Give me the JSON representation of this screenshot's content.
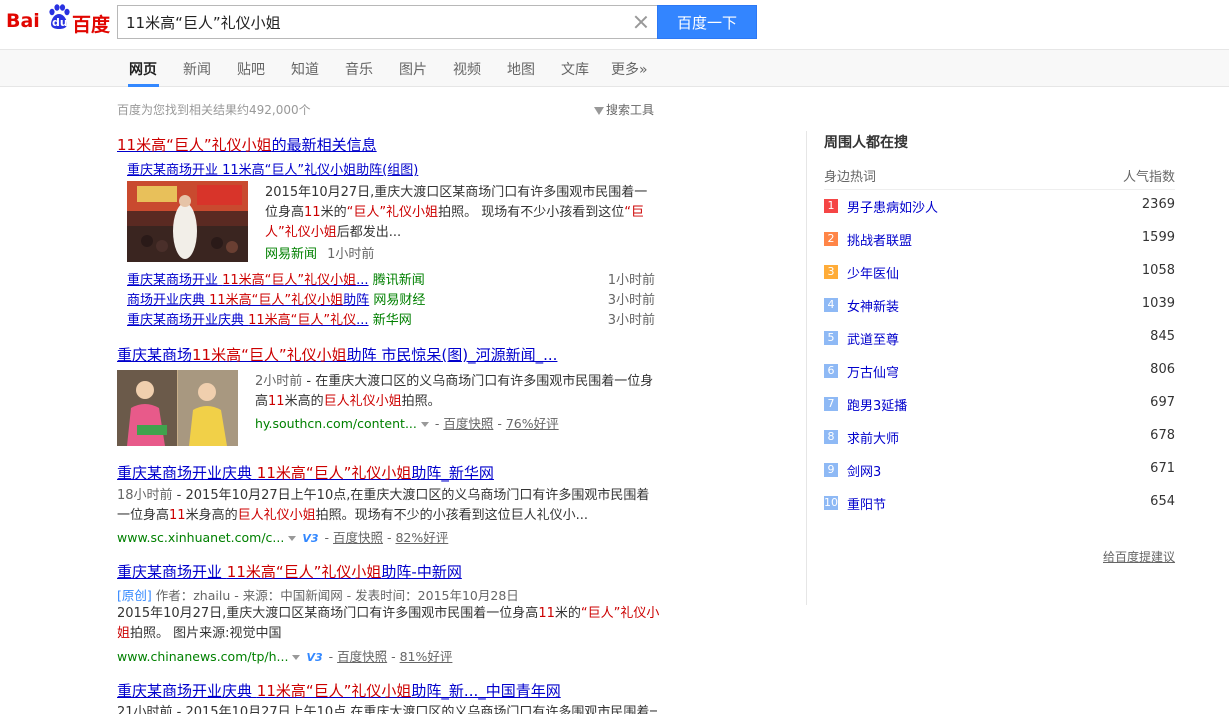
{
  "logo": {
    "left": "Bai",
    "paw": "du",
    "right": "百度"
  },
  "search": {
    "value": "11米高“巨人”礼仪小姐",
    "button_label": "百度一下"
  },
  "tabs": [
    "网页",
    "新闻",
    "贴吧",
    "知道",
    "音乐",
    "图片",
    "视频",
    "地图",
    "文库",
    "更多»"
  ],
  "results_info": {
    "count_text": "百度为您找到相关结果约492,000个",
    "tools_label": "搜索工具"
  },
  "news_block": {
    "title_a": "11米高“巨人”礼仪小姐",
    "title_b": "的最新相关信息",
    "sub_title": "重庆某商场开业 11米高“巨人”礼仪小姐助阵(组图)",
    "snippet_a": "2015年10月27日,重庆大渡口区某商场门口有许多围观市民围着一位身高",
    "snippet_em1": "11",
    "snippet_b": "米的",
    "snippet_em2": "“巨人”礼仪小姐",
    "snippet_c": "拍照。 现场有不少小孩看到这位",
    "snippet_em3": "“巨人”礼仪小姐",
    "snippet_d": "后都发出...",
    "source": "网易新闻",
    "time": "1小时前",
    "rows": [
      {
        "a": "重庆某商场开业 ",
        "em": "11米高“巨人”礼仪小姐",
        "b": "...",
        "source": "腾讯新闻",
        "time": "1小时前"
      },
      {
        "a": "商场开业庆典 ",
        "em": "11米高“巨人”礼仪小姐",
        "b": "助阵",
        "source": "网易财经",
        "time": "3小时前"
      },
      {
        "a": "重庆某商场开业庆典 ",
        "em": "11米高“巨人”礼仪",
        "b": "...",
        "source": "新华网",
        "time": "3小时前"
      }
    ]
  },
  "result2": {
    "title_a": "重庆某商场",
    "title_em": "11米高“巨人”礼仪小姐",
    "title_b": "助阵 市民惊呆(图)_河源新闻_...",
    "time": "2小时前",
    "snippet_a": " - 在重庆大渡口区的义乌商场门口有许多围观市民围着一位身高",
    "snippet_em1": "11",
    "snippet_b": "米高的",
    "snippet_em2": "巨人礼仪小姐",
    "snippet_c": "拍照。",
    "url": "hy.southcn.com/content...",
    "cache": "百度快照",
    "rating": "76%好评"
  },
  "result3": {
    "title_a": "重庆某商场开业庆典 ",
    "title_em": "11米高“巨人”礼仪小姐",
    "title_b": "助阵_新华网",
    "time": "18小时前",
    "snippet_a": " - 2015年10月27日上午10点,在重庆大渡口区的义乌商场门口有许多围观市民围着一位身高",
    "snippet_em1": "11",
    "snippet_b": "米身高的",
    "snippet_em2": "巨人礼仪小姐",
    "snippet_c": "拍照。现场有不少的小孩看到这位巨人礼仪小...",
    "url": "www.sc.xinhuanet.com/c...",
    "v": "V3",
    "cache": "百度快照",
    "rating": "82%好评"
  },
  "result4": {
    "title_a": "重庆某商场开业 ",
    "title_em": "11米高“巨人”礼仪小姐",
    "title_b": "助阵-中新网",
    "orig": "[原创]",
    "meta": " 作者：zhailu - 来源：中国新闻网 - 发表时间：2015年10月28日",
    "snippet_a": "2015年10月27日,重庆大渡口区某商场门口有许多围观市民围着一位身高",
    "snippet_em1": "11",
    "snippet_b": "米的",
    "snippet_em2": "“巨人”礼仪小姐",
    "snippet_c": "拍照。 图片来源:视觉中国",
    "url": "www.chinanews.com/tp/h...",
    "v": "V3",
    "cache": "百度快照",
    "rating": "81%好评"
  },
  "result5": {
    "title_a": "重庆某商场开业庆典 ",
    "title_em": "11米高“巨人”礼仪小姐",
    "title_b": "助阵_新..._中国青年网",
    "snippet": "21小时前 - 2015年10月27日上午10点,在重庆大渡口区的义乌商场门口有许多围观市民围着一"
  },
  "right": {
    "title": "周围人都在搜",
    "col_left": "身边热词",
    "col_right": "人气指数",
    "items": [
      {
        "rank": "1",
        "label": "男子患病如沙人",
        "value": "2369"
      },
      {
        "rank": "2",
        "label": "挑战者联盟",
        "value": "1599"
      },
      {
        "rank": "3",
        "label": "少年医仙",
        "value": "1058"
      },
      {
        "rank": "4",
        "label": "女神新装",
        "value": "1039"
      },
      {
        "rank": "5",
        "label": "武道至尊",
        "value": "845"
      },
      {
        "rank": "6",
        "label": "万古仙穹",
        "value": "806"
      },
      {
        "rank": "7",
        "label": "跑男3延播",
        "value": "697"
      },
      {
        "rank": "8",
        "label": "求前大师",
        "value": "678"
      },
      {
        "rank": "9",
        "label": "剑网3",
        "value": "671"
      },
      {
        "rank": "10",
        "label": "重阳节",
        "value": "654"
      }
    ],
    "feedback": "给百度提建议"
  },
  "colors": {
    "brand_red": "#e10601",
    "link": "#0000cc",
    "highlight": "#cc0000",
    "url_green": "#008000",
    "button_blue": "#3385ff"
  }
}
